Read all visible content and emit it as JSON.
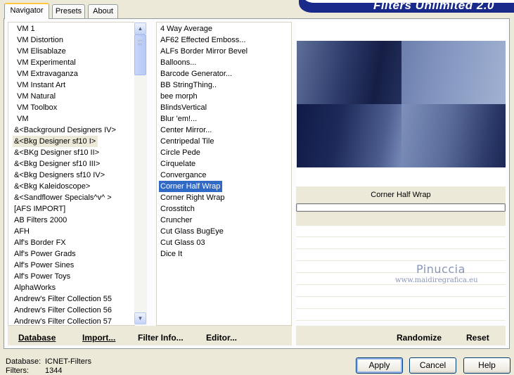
{
  "app": {
    "title": "Filters Unlimited 2.0"
  },
  "tabs": [
    {
      "label": "Navigator",
      "active": true
    },
    {
      "label": "Presets",
      "active": false
    },
    {
      "label": "About",
      "active": false
    }
  ],
  "categories": {
    "items": [
      "VM 1",
      "VM Distortion",
      "VM Elisablaze",
      "VM Experimental",
      "VM Extravaganza",
      "VM Instant Art",
      "VM Natural",
      "VM Toolbox",
      "VM",
      "&<Background Designers IV>",
      "&<Bkg Designer sf10 I>",
      "&<BKg Designer sf10 II>",
      "&<Bkg Designer sf10 III>",
      "&<Bkg Designers sf10 IV>",
      "&<Bkg Kaleidoscope>",
      "&<Sandflower Specials^v^ >",
      "[AFS IMPORT]",
      "AB Filters 2000",
      "AFH",
      "Alf's Border FX",
      "Alf's Power Grads",
      "Alf's Power Sines",
      "Alf's Power Toys",
      "AlphaWorks",
      "Andrew's Filter Collection 55",
      "Andrew's Filter Collection 56",
      "Andrew's Filter Collection 57"
    ],
    "selected_index": 10
  },
  "filters": {
    "items": [
      "4 Way Average",
      "AF62 Effected Emboss...",
      "ALFs Border Mirror Bevel",
      "Balloons...",
      "Barcode Generator...",
      "BB StringThing..",
      "bee morph",
      "BlindsVertical",
      "Blur 'em!...",
      "Center Mirror...",
      "Centripedal Tile",
      "Circle Pede",
      "Cirquelate",
      "Convergance",
      "Corner Half Wrap",
      "Corner Right Wrap",
      "Crosstitch",
      "Cruncher",
      "Cut Glass  BugEye",
      "Cut Glass 03",
      "Dice It"
    ],
    "selected_index": 14
  },
  "bottom_buttons": {
    "database": "Database",
    "import": "Import...",
    "filter_info": "Filter Info...",
    "editor": "Editor...",
    "randomize": "Randomize",
    "reset": "Reset"
  },
  "preview": {
    "filter_name": "Corner Half Wrap",
    "watermark_name": "Pinuccia",
    "watermark_url": "www.maidiregrafica.eu"
  },
  "status": {
    "database_label": "Database:",
    "database_value": "ICNET-Filters",
    "filters_label": "Filters:",
    "filters_value": "1344"
  },
  "dialog_buttons": {
    "apply": "Apply",
    "cancel": "Cancel",
    "help": "Help"
  },
  "colors": {
    "selection": "#316ac5",
    "banner": "#1a2a8a",
    "background": "#ece9d8"
  }
}
